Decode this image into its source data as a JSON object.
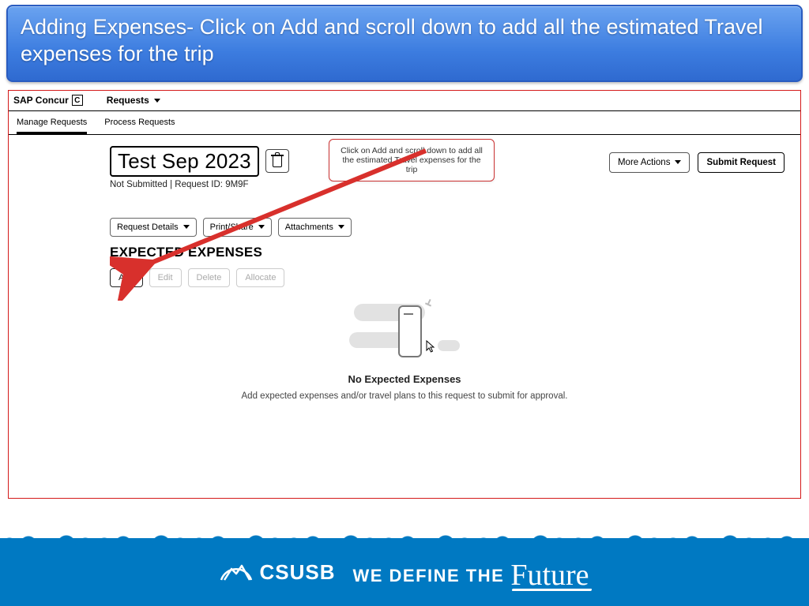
{
  "slide": {
    "header": "Adding Expenses- Click on Add and scroll down to add all the estimated Travel expenses for the trip"
  },
  "topbar": {
    "brand": "SAP Concur",
    "brand_badge": "C",
    "menu1": "Requests"
  },
  "subtabs": {
    "manage": "Manage Requests",
    "process": "Process Requests"
  },
  "request": {
    "title": "Test Sep 2023",
    "status": "Not Submitted",
    "sep": "  |  ",
    "id_label": "Request ID: ",
    "id": "9M9F"
  },
  "right": {
    "more": "More Actions",
    "submit": "Submit Request"
  },
  "toolbar": {
    "details": "Request Details",
    "print": "Print/Share",
    "attach": "Attachments"
  },
  "section": {
    "title": "EXPECTED EXPENSES"
  },
  "actions": {
    "add": "Add",
    "edit": "Edit",
    "delete": "Delete",
    "allocate": "Allocate"
  },
  "empty": {
    "title": "No Expected Expenses",
    "sub": "Add expected expenses and/or travel plans to this request to submit for approval."
  },
  "callout": {
    "text": "Click on Add and scroll down to add all the estimated Travel expenses for the trip"
  },
  "footer": {
    "org": "CSUSB",
    "tag_a": "WE DEFINE THE",
    "tag_b": "Future"
  }
}
